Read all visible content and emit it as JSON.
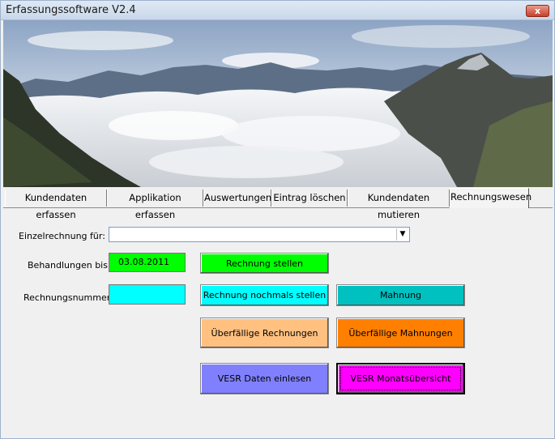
{
  "window": {
    "title": "Erfassungssoftware V2.4",
    "close_label": "x"
  },
  "tabs": [
    {
      "label": "Kundendaten erfassen"
    },
    {
      "label": "Applikation erfassen"
    },
    {
      "label": "Auswertungen"
    },
    {
      "label": "Eintrag löschen"
    },
    {
      "label": "Kundendaten mutieren"
    },
    {
      "label": "Rechnungswesen"
    }
  ],
  "form": {
    "einzelrechnung_label": "Einzelrechnung für:",
    "einzelrechnung_value": "",
    "behandlungen_label": "Behandlungen bis:",
    "behandlungen_value": "03.08.2011",
    "rechnungsnummer_label": "Rechnungsnummer:",
    "rechnungsnummer_value": ""
  },
  "buttons": {
    "rechnung_stellen": "Rechnung stellen",
    "rechnung_nochmals": "Rechnung nochmals stellen",
    "mahnung": "Mahnung",
    "ueberfaellige_rechnungen": "Überfällige Rechnungen",
    "ueberfaellige_mahnungen": "Überfällige Mahnungen",
    "vesr_einlesen": "VESR Daten einlesen",
    "vesr_monat": "VESR Monatsübersicht"
  },
  "colors": {
    "green": "#00ff00",
    "cyan": "#00ffff",
    "teal": "#00c0c0",
    "peach": "#ffc080",
    "orange": "#ff8000",
    "periwinkle": "#8080ff",
    "magenta": "#ff00ff"
  }
}
